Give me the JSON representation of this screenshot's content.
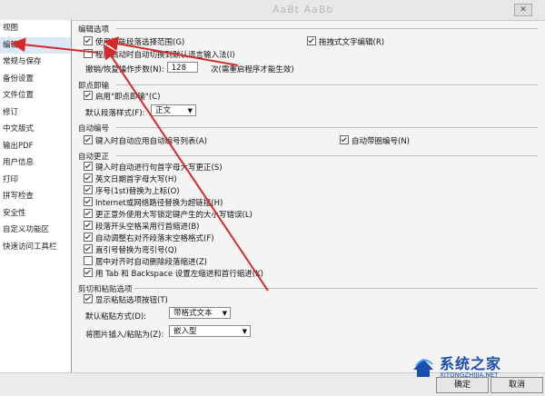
{
  "window": {
    "title_blurred": "AaBt AaBb",
    "close_glyph": "✕"
  },
  "sidebar": {
    "items": [
      {
        "label": "视图"
      },
      {
        "label": "编辑"
      },
      {
        "label": "常规与保存"
      },
      {
        "label": "备份设置"
      },
      {
        "label": "文件位置"
      },
      {
        "label": "修订"
      },
      {
        "label": "中文版式"
      },
      {
        "label": "输出PDF"
      },
      {
        "label": "用户信息"
      },
      {
        "label": "打印"
      },
      {
        "label": "拼写检查"
      },
      {
        "label": "安全性"
      },
      {
        "label": "自定义功能区"
      },
      {
        "label": "快速访问工具栏"
      }
    ],
    "active_index": 1
  },
  "groups": {
    "edit_options": {
      "title": "编辑选项",
      "smart_select": {
        "label": "使用智能段落选择范围(G)",
        "checked": true
      },
      "drag_text": {
        "label": "拖拽式文字编辑(R)",
        "checked": true
      },
      "auto_ime": {
        "label": "程序启动时自动切换到默认语言输入法(I)",
        "checked": false
      },
      "undo_label": "撤销/恢复操作步数(N):",
      "undo_value": "128",
      "undo_suffix": "次(需重启程序才能生效)"
    },
    "clipboard_mode": {
      "title": "即点即输",
      "enable": {
        "label": "启用\"即点即输\"(C)",
        "checked": true
      },
      "default_style_label": "默认段落样式(F):",
      "default_style_value": "正文"
    },
    "auto_numbering": {
      "title": "自动编号",
      "apply_list": {
        "label": "键入时自动应用自动编号列表(A)",
        "checked": true
      },
      "circle_num": {
        "label": "自动带圈编号(N)",
        "checked": true
      }
    },
    "auto_correct": {
      "title": "自动更正",
      "items": [
        {
          "label": "键入时自动进行句首字母大写更正(S)",
          "checked": true
        },
        {
          "label": "英文日期首字母大写(H)",
          "checked": true
        },
        {
          "label": "序号(1st)替换为上标(O)",
          "checked": true
        },
        {
          "label": "Internet或网络路径替换为超链接(H)",
          "checked": true
        },
        {
          "label": "更正意外使用大写锁定键产生的大小写错误(L)",
          "checked": true
        },
        {
          "label": "段落开头空格采用行首缩进(B)",
          "checked": true
        },
        {
          "label": "自动调整右对齐段落末空格格式(F)",
          "checked": true
        },
        {
          "label": "直引号替换为弯引号(Q)",
          "checked": true
        },
        {
          "label": "居中对齐时自动删除段落缩进(Z)",
          "checked": false
        },
        {
          "label": "用 Tab 和 Backspace 设置左缩进和首行缩进(K)",
          "checked": true
        }
      ]
    },
    "cut_paste": {
      "title": "剪切和粘贴选项",
      "show_button": {
        "label": "显示粘贴选项按钮(T)",
        "checked": true
      },
      "default_paste_label": "默认粘贴方式(D):",
      "default_paste_value": "带格式文本",
      "picture_label": "将图片插入/粘贴为(Z):",
      "picture_value": "嵌入型"
    }
  },
  "buttons": {
    "ok": "确定",
    "cancel": "取消"
  },
  "watermark": {
    "name": "系统之家",
    "url": "XITONGZHIJIA.NET"
  },
  "colors": {
    "annotation_arrow": "#d42a2a",
    "sidebar_active": "#dbe8f7",
    "watermark": "#1a4fb0"
  }
}
